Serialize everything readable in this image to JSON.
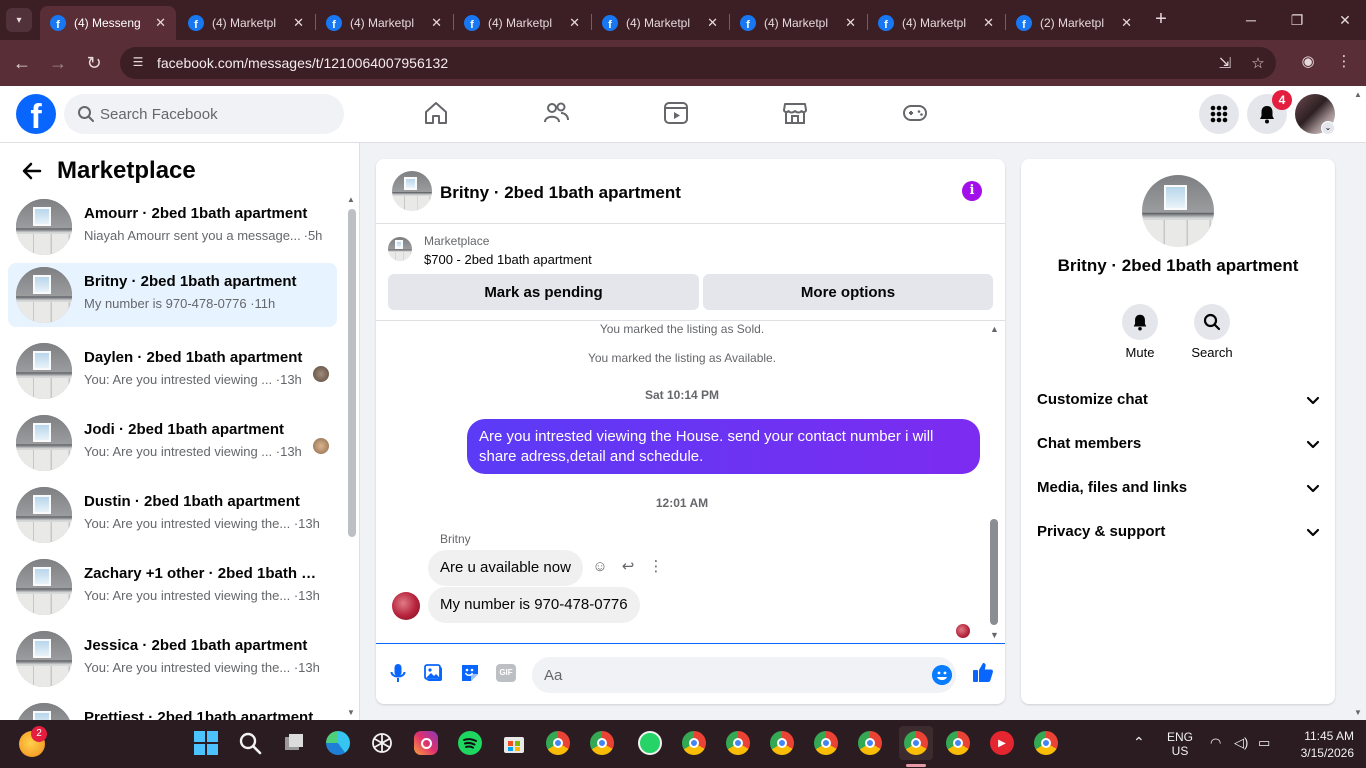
{
  "browser": {
    "tabs": [
      {
        "title": "(4) Messeng",
        "active": true
      },
      {
        "title": "(4) Marketpl",
        "active": false
      },
      {
        "title": "(4) Marketpl",
        "active": false
      },
      {
        "title": "(4) Marketpl",
        "active": false
      },
      {
        "title": "(4) Marketpl",
        "active": false
      },
      {
        "title": "(4) Marketpl",
        "active": false
      },
      {
        "title": "(4) Marketpl",
        "active": false
      },
      {
        "title": "(2) Marketpl",
        "active": false
      }
    ],
    "url": "facebook.com/messages/t/1210064007956132"
  },
  "header": {
    "logo": "f",
    "search_placeholder": "Search Facebook",
    "notification_count": "4"
  },
  "sidebar": {
    "title": "Marketplace",
    "conversations": [
      {
        "name": "Amourr · 2bed 1bath apartment",
        "preview": "Niayah Amourr sent you a message...",
        "time": "5h",
        "selected": false
      },
      {
        "name": "Britny · 2bed 1bath apartment",
        "preview": "My number is 970-478-0776",
        "time": "11h",
        "selected": true
      },
      {
        "name": "Daylen · 2bed 1bath apartment",
        "preview": "You: Are you intrested viewing ...",
        "time": "13h",
        "selected": false
      },
      {
        "name": "Jodi · 2bed 1bath apartment",
        "preview": "You: Are you intrested viewing ...",
        "time": "13h",
        "selected": false
      },
      {
        "name": "Dustin · 2bed 1bath apartment",
        "preview": "You: Are you intrested viewing the...",
        "time": "13h",
        "selected": false
      },
      {
        "name": "Zachary +1 other · 2bed 1bath a...",
        "preview": "You: Are you intrested viewing the...",
        "time": "13h",
        "selected": false
      },
      {
        "name": "Jessica · 2bed 1bath apartment",
        "preview": "You: Are you intrested viewing the...",
        "time": "13h",
        "selected": false
      },
      {
        "name": "Prettiest · 2bed 1bath apartment",
        "preview": "",
        "time": "",
        "selected": false
      }
    ]
  },
  "chat": {
    "title": "Britny · 2bed 1bath apartment",
    "listing_source": "Marketplace",
    "listing_title": "$700 - 2bed 1bath apartment",
    "mark_pending_label": "Mark as pending",
    "more_options_label": "More options",
    "system_messages": [
      "You marked the listing as Sold.",
      "You marked the listing as Available."
    ],
    "timestamp_1": "Sat 10:14 PM",
    "outgoing_message": "Are you intrested viewing the House. send your contact number i will share adress,detail and schedule.",
    "timestamp_2": "12:01 AM",
    "sender_name": "Britny",
    "incoming_messages": [
      "Are u available now",
      "My number is 970-478-0776"
    ],
    "composer_placeholder": "Aa",
    "gif_label": "GIF"
  },
  "info_panel": {
    "name": "Britny · 2bed 1bath apartment",
    "mute_label": "Mute",
    "search_label": "Search",
    "sections": [
      "Customize chat",
      "Chat members",
      "Media, files and links",
      "Privacy & support"
    ]
  },
  "taskbar": {
    "notification_badge": "2",
    "lang_1": "ENG",
    "lang_2": "US",
    "time": "11:45 AM",
    "date": "3/15/2026"
  },
  "colors": {
    "facebook_blue": "#0866ff",
    "outgoing_bubble": "#6f2cf5",
    "selected_conversation": "#e7f3ff",
    "notification_red": "#e41e3f",
    "browser_frame": "#5a2e36"
  }
}
